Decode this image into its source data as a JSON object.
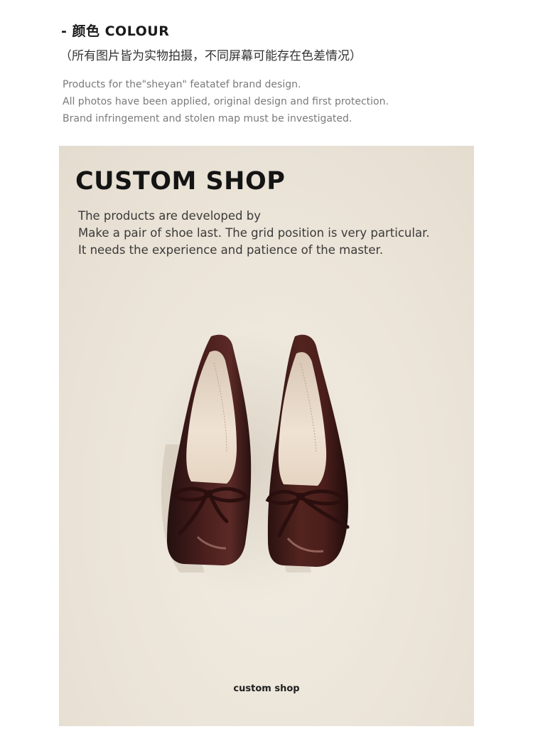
{
  "header": {
    "colour_title": "- 颜色 COLOUR",
    "colour_note": "（所有图片皆为实物拍摄，不同屏幕可能存在色差情况）",
    "disclaimer": [
      "Products for the\"sheyan\" featatef brand design.",
      "All photos have been applied, original design and first protection.",
      "Brand infringement and stolen map must be investigated."
    ]
  },
  "card": {
    "title": "CUSTOM SHOP",
    "description": [
      "The products are developed by",
      "Make a pair of shoe last. The grid position is very particular.",
      "It needs the experience and patience of the master."
    ],
    "caption": "custom shop"
  },
  "colors": {
    "card_background": "#ebe4d8",
    "shoe_leather": "#3a1616",
    "shoe_lining": "#e9d9c8"
  }
}
